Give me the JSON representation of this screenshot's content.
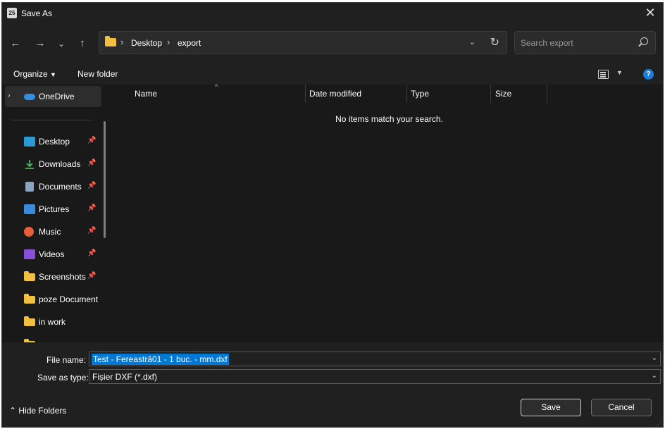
{
  "window": {
    "title": "Save As",
    "close_label": "✕"
  },
  "nav": {
    "back": "←",
    "forward": "→",
    "recent": "⌄",
    "up": "↑"
  },
  "address": {
    "breadcrumb": [
      "Desktop",
      "export"
    ],
    "separator": "›"
  },
  "search": {
    "placeholder": "Search export"
  },
  "toolbar": {
    "organize": "Organize",
    "new_folder": "New folder",
    "help": "?"
  },
  "sidebar": {
    "items": [
      {
        "label": "OneDrive",
        "icon": "onedrive-icon",
        "pinned": false
      },
      {
        "label": "Desktop",
        "icon": "desktop-icon",
        "pinned": true
      },
      {
        "label": "Downloads",
        "icon": "download-icon",
        "pinned": true
      },
      {
        "label": "Documents",
        "icon": "document-icon",
        "pinned": true
      },
      {
        "label": "Pictures",
        "icon": "pictures-icon",
        "pinned": true
      },
      {
        "label": "Music",
        "icon": "music-icon",
        "pinned": true
      },
      {
        "label": "Videos",
        "icon": "videos-icon",
        "pinned": true
      },
      {
        "label": "Screenshots",
        "icon": "folder-icon",
        "pinned": true
      },
      {
        "label": "poze Document",
        "icon": "folder-icon",
        "pinned": false
      },
      {
        "label": "in work",
        "icon": "folder-icon",
        "pinned": false
      }
    ]
  },
  "columns": [
    "Name",
    "Date modified",
    "Type",
    "Size"
  ],
  "content": {
    "empty_message": "No items match your search."
  },
  "form": {
    "file_name_label": "File name:",
    "file_name_value": "Test - Fereastră01 - 1 buc. - mm.dxf",
    "save_type_label": "Save as type:",
    "save_type_value": "Fișier DXF (*.dxf)"
  },
  "footer": {
    "hide_folders": "Hide Folders",
    "save": "Save",
    "cancel": "Cancel"
  },
  "colors": {
    "accent": "#0078d4",
    "background": "#191919",
    "panel": "#202020",
    "folder": "#f1c040"
  }
}
